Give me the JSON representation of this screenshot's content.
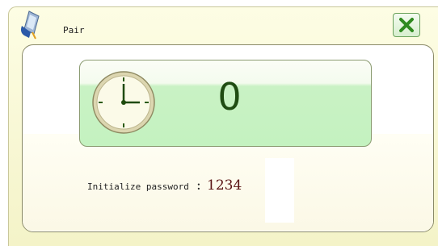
{
  "window": {
    "title": "Pair"
  },
  "timer": {
    "count": "0"
  },
  "password": {
    "label": "Initialize password",
    "separator": ":",
    "value": "1234"
  },
  "icons": {
    "app": "bluetooth-device-icon",
    "close": "close-x-icon",
    "clock": "clock-icon"
  },
  "colors": {
    "accent_green": "#2f8a1f",
    "timer_background": "#c4f2c0",
    "count_text": "#1f4c12",
    "password_value": "#5a1414"
  }
}
